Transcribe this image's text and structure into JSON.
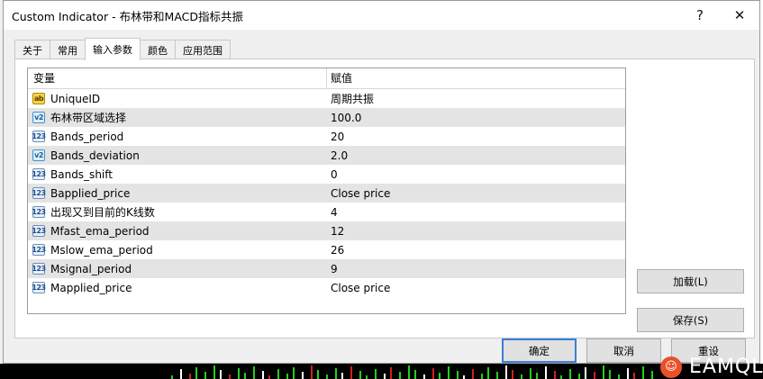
{
  "window": {
    "title": "Custom Indicator - 布林带和MACD指标共振",
    "help_label": "?",
    "close_label": "✕"
  },
  "tabs": [
    {
      "label": "关于",
      "active": false
    },
    {
      "label": "常用",
      "active": false
    },
    {
      "label": "输入参数",
      "active": true
    },
    {
      "label": "颜色",
      "active": false
    },
    {
      "label": "应用范围",
      "active": false
    }
  ],
  "grid": {
    "col_variable": "变量",
    "col_value": "赋值",
    "rows": [
      {
        "icon": "ab",
        "name": "UniqueID",
        "value": "周期共振"
      },
      {
        "icon": "v2",
        "name": "布林带区域选择",
        "value": "100.0"
      },
      {
        "icon": "123",
        "name": "Bands_period",
        "value": "20"
      },
      {
        "icon": "v2",
        "name": "Bands_deviation",
        "value": "2.0"
      },
      {
        "icon": "123",
        "name": "Bands_shift",
        "value": "0"
      },
      {
        "icon": "123",
        "name": "Bapplied_price",
        "value": "Close price"
      },
      {
        "icon": "123",
        "name": "出现又到目前的K线数",
        "value": "4"
      },
      {
        "icon": "123",
        "name": "Mfast_ema_period",
        "value": "12"
      },
      {
        "icon": "123",
        "name": "Mslow_ema_period",
        "value": "26"
      },
      {
        "icon": "123",
        "name": "Msignal_period",
        "value": "9"
      },
      {
        "icon": "123",
        "name": "Mapplied_price",
        "value": "Close price"
      }
    ]
  },
  "buttons": {
    "load": "加载(L)",
    "save": "保存(S)",
    "ok": "确定",
    "cancel": "取消",
    "reset": "重设"
  },
  "watermark": {
    "logo_glyph": "☺",
    "text": "EAMQL"
  },
  "colors": {
    "accent": "#3c7fd4",
    "alt_row": "#e4e4e4",
    "watermark_logo": "#e8512a"
  }
}
